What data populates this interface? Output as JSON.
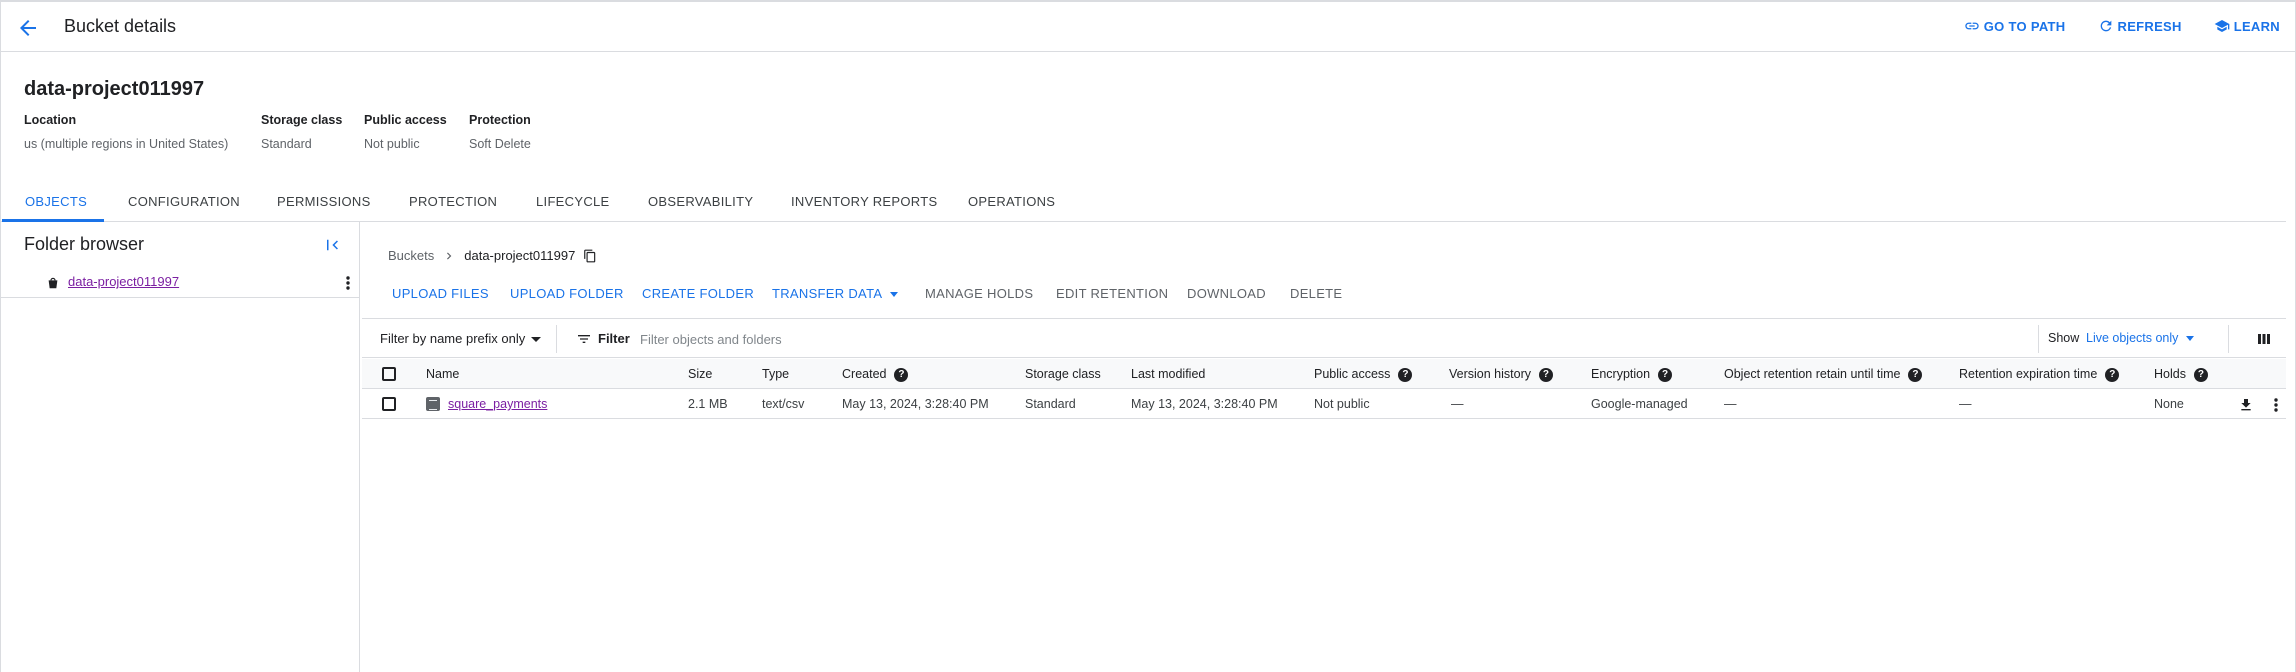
{
  "header": {
    "title": "Bucket details",
    "actions": [
      {
        "label": "GO TO PATH",
        "icon": "link-icon"
      },
      {
        "label": "REFRESH",
        "icon": "refresh-icon"
      },
      {
        "label": "LEARN",
        "icon": "school-icon"
      }
    ]
  },
  "bucket": {
    "name": "data-project011997",
    "meta": [
      {
        "key": "Location",
        "value": "us (multiple regions in United States)"
      },
      {
        "key": "Storage class",
        "value": "Standard"
      },
      {
        "key": "Public access",
        "value": "Not public"
      },
      {
        "key": "Protection",
        "value": "Soft Delete"
      }
    ]
  },
  "tabs": [
    "OBJECTS",
    "CONFIGURATION",
    "PERMISSIONS",
    "PROTECTION",
    "LIFECYCLE",
    "OBSERVABILITY",
    "INVENTORY REPORTS",
    "OPERATIONS"
  ],
  "active_tab": "OBJECTS",
  "folder_browser": {
    "title": "Folder browser",
    "items": [
      {
        "label": "data-project011997"
      }
    ]
  },
  "breadcrumb": {
    "root": "Buckets",
    "current": "data-project011997"
  },
  "toolbar": {
    "upload_files": "UPLOAD FILES",
    "upload_folder": "UPLOAD FOLDER",
    "create_folder": "CREATE FOLDER",
    "transfer_data": "TRANSFER DATA",
    "manage_holds": "MANAGE HOLDS",
    "edit_retention": "EDIT RETENTION",
    "download": "DOWNLOAD",
    "delete": "DELETE"
  },
  "filterbar": {
    "prefix_mode": "Filter by name prefix only",
    "filter_label": "Filter",
    "filter_placeholder": "Filter objects and folders",
    "show_label": "Show",
    "show_value": "Live objects only"
  },
  "table": {
    "columns": {
      "name": "Name",
      "size": "Size",
      "type": "Type",
      "created": "Created",
      "storage_class": "Storage class",
      "last_modified": "Last modified",
      "public_access": "Public access",
      "version_history": "Version history",
      "encryption": "Encryption",
      "object_retention": "Object retention retain until time",
      "retention_expiration": "Retention expiration time",
      "holds": "Holds"
    },
    "rows": [
      {
        "name": "square_payments",
        "size": "2.1 MB",
        "type": "text/csv",
        "created": "May 13, 2024, 3:28:40 PM",
        "storage_class": "Standard",
        "last_modified": "May 13, 2024, 3:28:40 PM",
        "public_access": "Not public",
        "version_history": "—",
        "encryption": "Google-managed",
        "object_retention": "—",
        "retention_expiration": "—",
        "holds": "None"
      }
    ]
  },
  "colors": {
    "accent": "#1a73e8",
    "link_visited": "#7b1fa2",
    "border": "#dadce0"
  }
}
